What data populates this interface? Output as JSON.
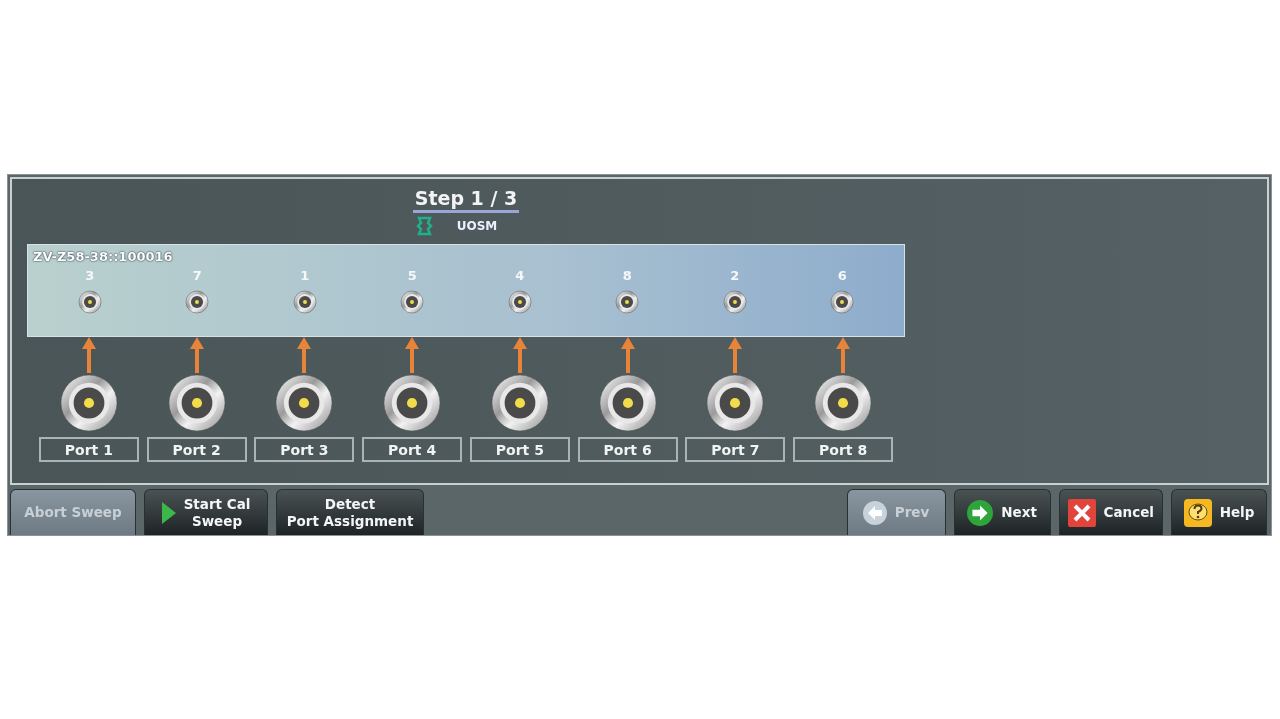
{
  "header": {
    "step": "Step 1 / 3",
    "cal_kit": "UOSM"
  },
  "cal_unit": {
    "name": "ZV-Z58-38::100016"
  },
  "ports": [
    {
      "label": "Port 1",
      "cal_port": "3"
    },
    {
      "label": "Port 2",
      "cal_port": "7"
    },
    {
      "label": "Port 3",
      "cal_port": "1"
    },
    {
      "label": "Port 4",
      "cal_port": "5"
    },
    {
      "label": "Port 5",
      "cal_port": "4"
    },
    {
      "label": "Port 6",
      "cal_port": "8"
    },
    {
      "label": "Port 7",
      "cal_port": "2"
    },
    {
      "label": "Port 8",
      "cal_port": "6"
    }
  ],
  "left_buttons": [
    {
      "label": "Abort Sweep",
      "kind": "plain",
      "disabled": true
    },
    {
      "label": "Start Cal\nSweep",
      "kind": "play",
      "disabled": false
    },
    {
      "label": "Detect\nPort Assignment",
      "kind": "plain",
      "disabled": false
    }
  ],
  "right_buttons": [
    {
      "label": "Prev",
      "kind": "back",
      "disabled": true
    },
    {
      "label": "Next",
      "kind": "forward",
      "disabled": false
    },
    {
      "label": "Cancel",
      "kind": "cancel",
      "disabled": false
    },
    {
      "label": "Help",
      "kind": "help",
      "disabled": false
    }
  ]
}
